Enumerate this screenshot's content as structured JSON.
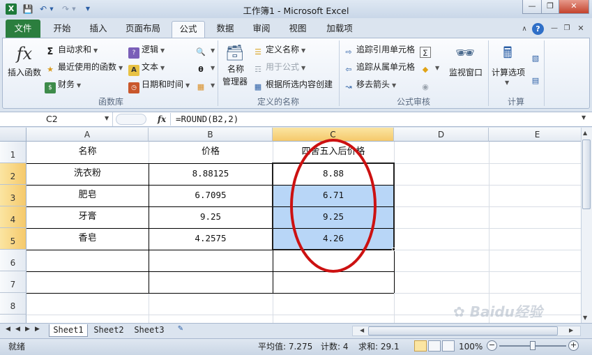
{
  "window": {
    "title": "工作簿1 - Microsoft Excel"
  },
  "ribbon_tabs": [
    "文件",
    "开始",
    "插入",
    "页面布局",
    "公式",
    "数据",
    "审阅",
    "视图",
    "加载项"
  ],
  "ribbon": {
    "insert_function": "插入函数",
    "function_library": {
      "label": "函数库",
      "autosum": "自动求和",
      "recent": "最近使用的函数",
      "financial": "财务",
      "logical": "逻辑",
      "text": "文本",
      "datetime": "日期和时间"
    },
    "defined_names": {
      "label": "定义的名称",
      "name_manager": "名称\n管理器",
      "name_manager_l1": "名称",
      "name_manager_l2": "管理器",
      "define_name": "定义名称",
      "use_in_formula": "用于公式",
      "create_from_selection": "根据所选内容创建"
    },
    "formula_auditing": {
      "label": "公式审核",
      "trace_precedents": "追踪引用单元格",
      "trace_dependents": "追踪从属单元格",
      "remove_arrows": "移去箭头",
      "watch_window": "监视窗口"
    },
    "calculation": {
      "label": "计算",
      "options": "计算选项"
    }
  },
  "formula_bar": {
    "name_box": "C2",
    "fx": "fx",
    "formula": "=ROUND(B2,2)"
  },
  "columns": [
    "A",
    "B",
    "C",
    "D",
    "E"
  ],
  "rows": [
    "1",
    "2",
    "3",
    "4",
    "5",
    "6",
    "7",
    "8"
  ],
  "table": {
    "headers": [
      "名称",
      "价格",
      "四舍五入后价格"
    ],
    "rows": [
      [
        "洗衣粉",
        "8.88125",
        "8.88"
      ],
      [
        "肥皂",
        "6.7095",
        "6.71"
      ],
      [
        "牙膏",
        "9.25",
        "9.25"
      ],
      [
        "香皂",
        "4.2575",
        "4.26"
      ]
    ]
  },
  "sheets": [
    "Sheet1",
    "Sheet2",
    "Sheet3"
  ],
  "status": {
    "mode": "就绪",
    "average": "平均值: 7.275",
    "count": "计数: 4",
    "sum": "求和: 29.1",
    "zoom": "100%"
  },
  "watermark": "Baidu经验",
  "colors": {
    "file_tab": "#2b7e3e",
    "selection": "#b8d6f7",
    "annotation_ellipse": "#cc1111",
    "header_selected": "#f5c96b"
  }
}
